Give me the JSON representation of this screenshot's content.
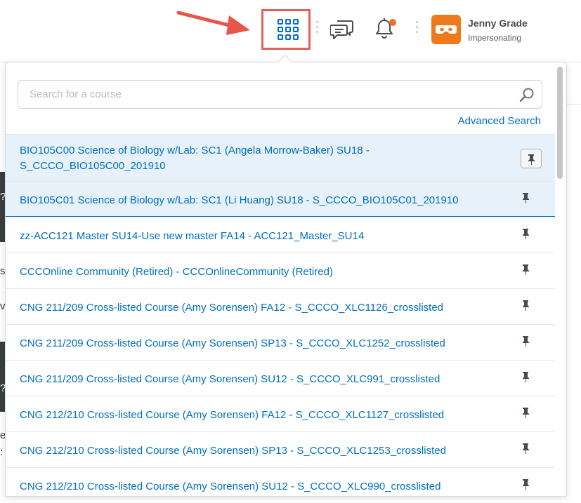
{
  "header": {
    "user_name": "Jenny Grade",
    "user_role": "Impersonating",
    "icons": [
      "course-selector-waffle-icon",
      "message-alerts-icon",
      "notification-bell-icon",
      "impersonation-mask-icon"
    ],
    "colors": {
      "accent_link": "#006fbf",
      "notification_dot": "#f06d24",
      "avatar_bg": "#ee7a1c",
      "highlight_box": "#e0625a"
    }
  },
  "course_selector": {
    "search_placeholder": "Search for a course",
    "search_value": "",
    "advanced_search_label": "Advanced Search",
    "courses": [
      {
        "label": "BIO105C00 Science of Biology w/Lab: SC1 (Angela Morrow-Baker) SU18 - S_CCCO_BIO105C00_201910"
      },
      {
        "label": "BIO105C01 Science of Biology w/Lab: SC1 (Li Huang) SU18 - S_CCCO_BIO105C01_201910"
      },
      {
        "label": "zz-ACC121 Master SU14-Use new master FA14 - ACC121_Master_SU14"
      },
      {
        "label": "CCCOnline Community (Retired) - CCCOnlineCommunity (Retired)"
      },
      {
        "label": "CNG 211/209 Cross-listed Course (Amy Sorensen) FA12 - S_CCCO_XLC1126_crosslisted"
      },
      {
        "label": "CNG 211/209 Cross-listed Course (Amy Sorensen) SP13 - S_CCCO_XLC1252_crosslisted"
      },
      {
        "label": "CNG 211/209 Cross-listed Course (Amy Sorensen) SU12 - S_CCCO_XLC991_crosslisted"
      },
      {
        "label": "CNG 212/210 Cross-listed Course (Amy Sorensen) FA12 - S_CCCO_XLC1127_crosslisted"
      },
      {
        "label": "CNG 212/210 Cross-listed Course (Amy Sorensen) SP13 - S_CCCO_XLC1253_crosslisted"
      },
      {
        "label": "CNG 212/210 Cross-listed Course (Amy Sorensen) SU12 - S_CCCO_XLC990_crosslisted"
      }
    ]
  },
  "background_fragments": [
    "?",
    "s",
    "v",
    "?",
    "e",
    ":"
  ]
}
